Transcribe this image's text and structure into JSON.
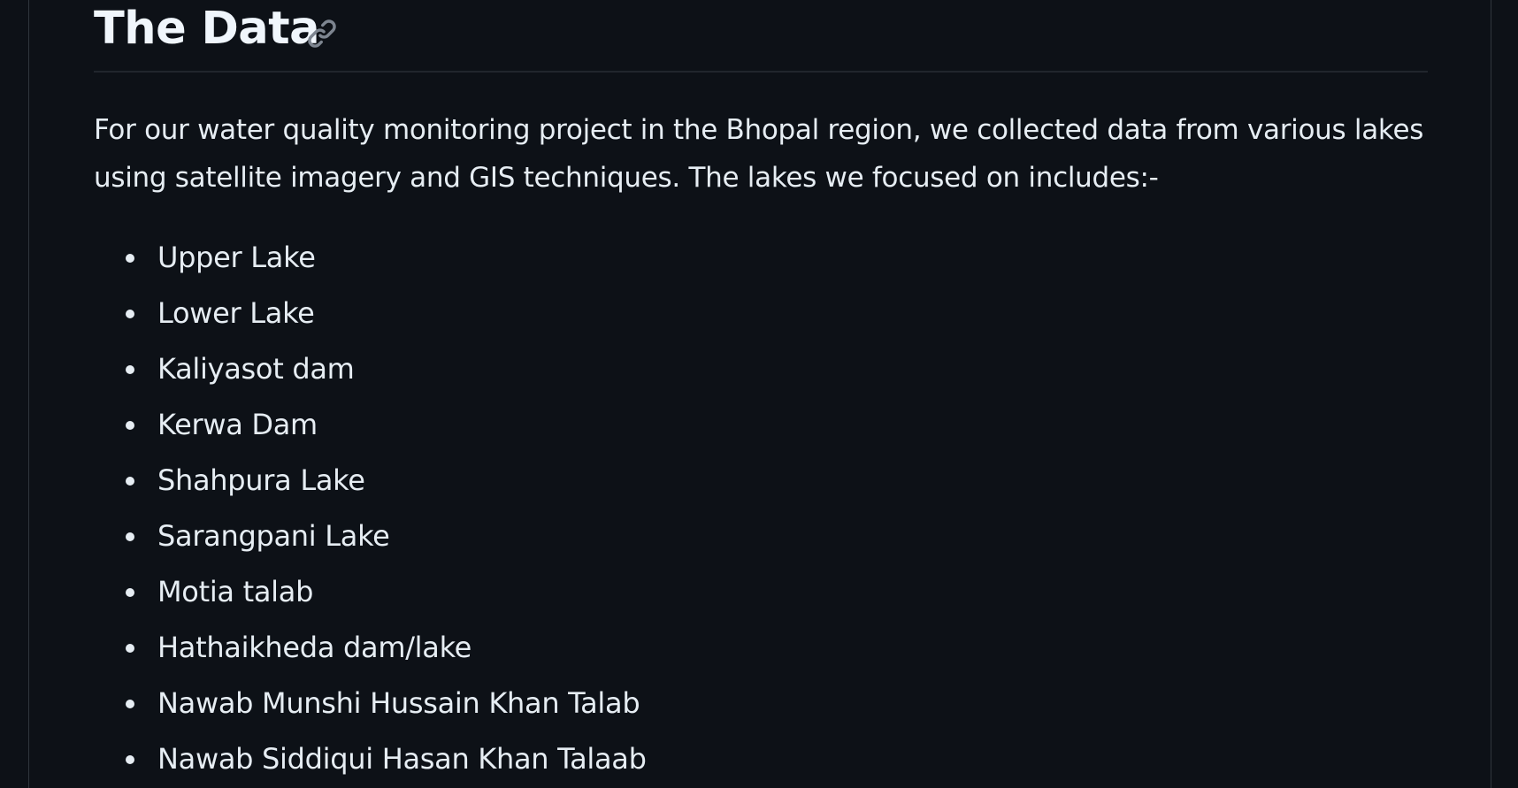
{
  "section": {
    "title": "The Data",
    "anchor_icon": "link-icon",
    "intro": "For our water quality monitoring project in the Bhopal region, we collected data from various lakes using satellite imagery and GIS techniques. The lakes we focused on includes:-",
    "lakes": [
      "Upper Lake",
      "Lower Lake",
      "Kaliyasot dam",
      "Kerwa Dam",
      "Shahpura Lake",
      "Sarangpani Lake",
      "Motia talab",
      "Hathaikheda dam/lake",
      "Nawab Munshi Hussain Khan Talab",
      "Nawab Siddiqui Hasan Khan Talaab"
    ]
  },
  "colors": {
    "background": "#0d1117",
    "text": "#e6edf3",
    "heading": "#f0f6fc",
    "divider": "#21262d",
    "icon": "#7d8590"
  }
}
